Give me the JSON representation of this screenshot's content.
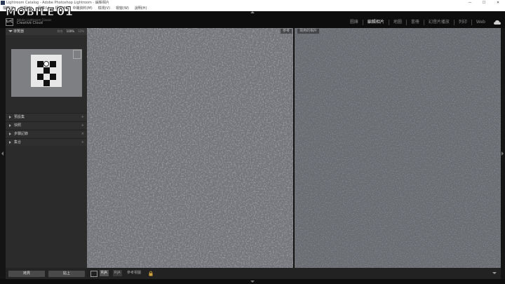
{
  "window": {
    "title": "Lightroom Catalog - Adobe Photoshop Lightroom - 編輯相片",
    "controls": [
      "—",
      "☐",
      "✕"
    ]
  },
  "menu": {
    "items": [
      "檔案(F)",
      "編輯(E)",
      "圖庫(L)",
      "相片(P)",
      "中繼資料(M)",
      "檢視(V)",
      "視窗(W)",
      "說明(H)"
    ]
  },
  "watermark": {
    "text": "MOBILE",
    "suffix": "01"
  },
  "brand": {
    "logo": "LrC",
    "line1": "Adobe Lightroom Classic",
    "line2": "Creative Cloud"
  },
  "modules": [
    {
      "label": "圖庫",
      "active": false
    },
    {
      "label": "編輯相片",
      "active": true
    },
    {
      "label": "地圖",
      "active": false
    },
    {
      "label": "書冊",
      "active": false
    },
    {
      "label": "幻燈片播放",
      "active": false
    },
    {
      "label": "列印",
      "active": false
    },
    {
      "label": "Web",
      "active": false
    }
  ],
  "navigator": {
    "title": "導覽器",
    "zooms": [
      "符合",
      "100%",
      "12%"
    ],
    "selected_zoom": "100%"
  },
  "panels": [
    {
      "label": "預設集"
    },
    {
      "label": "快照"
    },
    {
      "label": "步驟記錄"
    },
    {
      "label": "集合"
    }
  ],
  "left_buttons": {
    "copy": "拷貝",
    "paste": "貼上"
  },
  "views": {
    "before": "參考",
    "after": "現用的相片"
  },
  "toolbar": {
    "mode_a": "R|A",
    "mode_b": "R|A",
    "ref_view": "參考視圖",
    "lock_icon": "lock-icon"
  },
  "colors": {
    "accent": "#e6e6e6",
    "panel": "#2b2b2b",
    "background": "#1a1a1a"
  }
}
